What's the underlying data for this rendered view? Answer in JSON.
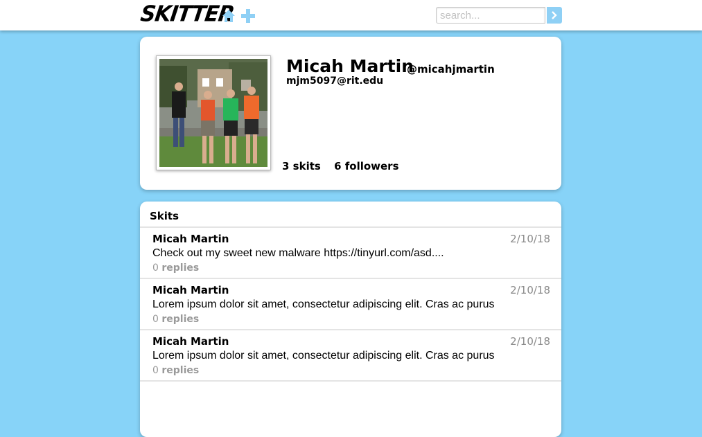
{
  "header": {
    "logo": "SKITTER",
    "home_icon": "home-icon",
    "add_icon": "plus-icon",
    "search": {
      "placeholder": "search...",
      "value": ""
    },
    "search_button_icon": "chevron-right-icon",
    "accent_color": "#87d3f8"
  },
  "profile": {
    "photo_description": "group-photo",
    "name": "Micah Martin",
    "handle": "@micahjmartin",
    "email": "mjm5097@rit.edu",
    "skits_count": "3",
    "skits_label": "skits",
    "followers_count": "6",
    "followers_label": "followers"
  },
  "skits": {
    "title": "Skits",
    "items": [
      {
        "author": "Micah Martin",
        "date": "2/10/18",
        "body": "Check out my sweet new malware https://tinyurl.com/asd....",
        "replies_count": "0",
        "replies_label": "replies"
      },
      {
        "author": "Micah Martin",
        "date": "2/10/18",
        "body": "Lorem ipsum dolor sit amet, consectetur adipiscing elit. Cras ac purus",
        "replies_count": "0",
        "replies_label": "replies"
      },
      {
        "author": "Micah Martin",
        "date": "2/10/18",
        "body": "Lorem ipsum dolor sit amet, consectetur adipiscing elit. Cras ac purus",
        "replies_count": "0",
        "replies_label": "replies"
      }
    ]
  }
}
